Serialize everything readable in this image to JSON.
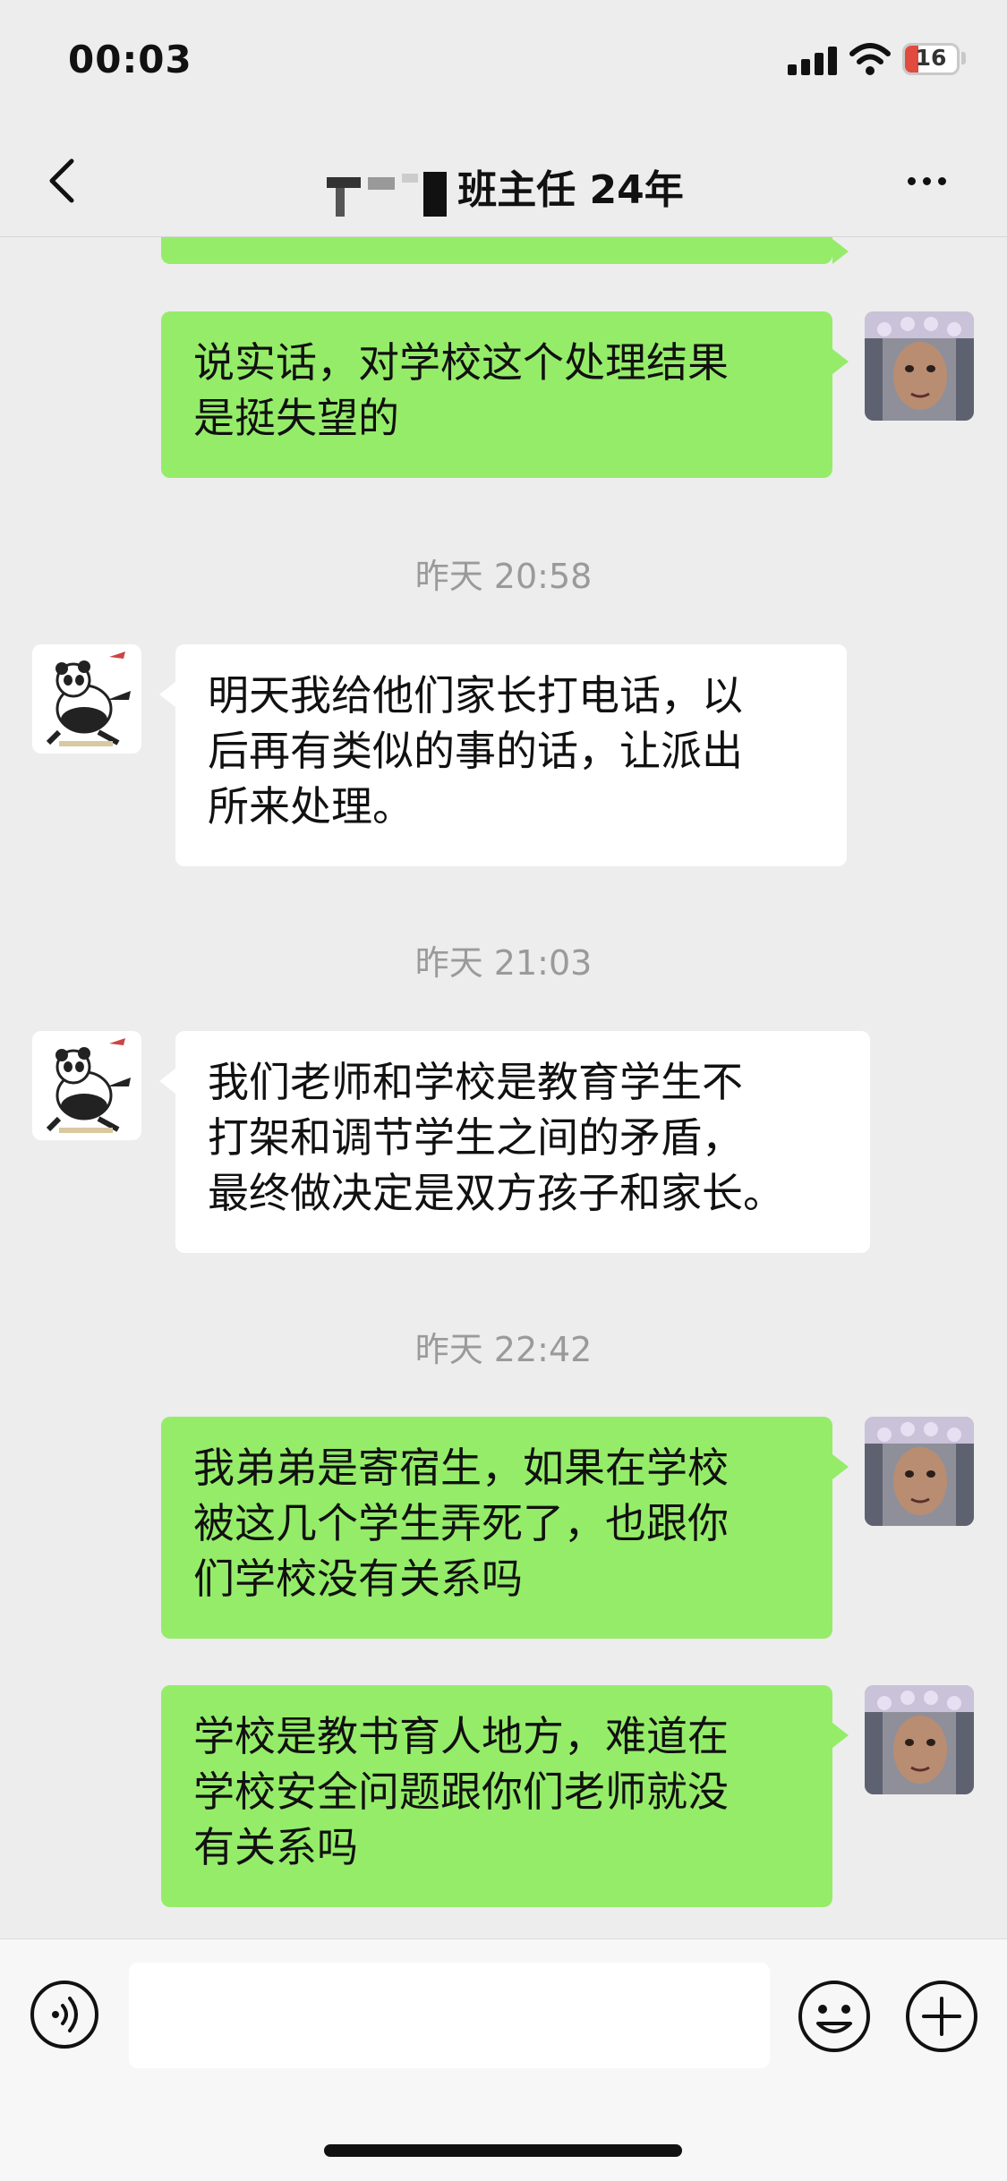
{
  "status_bar": {
    "time": "00:03",
    "battery_level": "16"
  },
  "nav": {
    "back_icon": "chevron-left-icon",
    "title": "班主任 24年",
    "more_icon": "more-dots-icon"
  },
  "messages": [
    {
      "type": "out",
      "text": ""
    },
    {
      "type": "out",
      "text": "说实话，对学校这个处理结果\n是挺失望的"
    },
    {
      "type": "time",
      "text": "昨天 20:58"
    },
    {
      "type": "in",
      "text": "明天我给他们家长打电话，以\n后再有类似的事的话，让派出\n所来处理。"
    },
    {
      "type": "time",
      "text": "昨天 21:03"
    },
    {
      "type": "in",
      "text": "我们老师和学校是教育学生不\n打架和调节学生之间的矛盾，\n最终做决定是双方孩子和家长。"
    },
    {
      "type": "time",
      "text": "昨天 22:42"
    },
    {
      "type": "out",
      "text": "我弟弟是寄宿生，如果在学校\n被这几个学生弄死了，也跟你\n们学校没有关系吗"
    },
    {
      "type": "out",
      "text": "学校是教书育人地方，难道在\n学校安全问题跟你们老师就没\n有关系吗"
    }
  ],
  "input_bar": {
    "voice_icon": "voice-icon",
    "emoji_icon": "emoji-icon",
    "plus_icon": "plus-icon",
    "input_value": ""
  },
  "colors": {
    "outgoing_bubble": "#95ec69",
    "incoming_bubble": "#ffffff",
    "background": "#ededed"
  }
}
